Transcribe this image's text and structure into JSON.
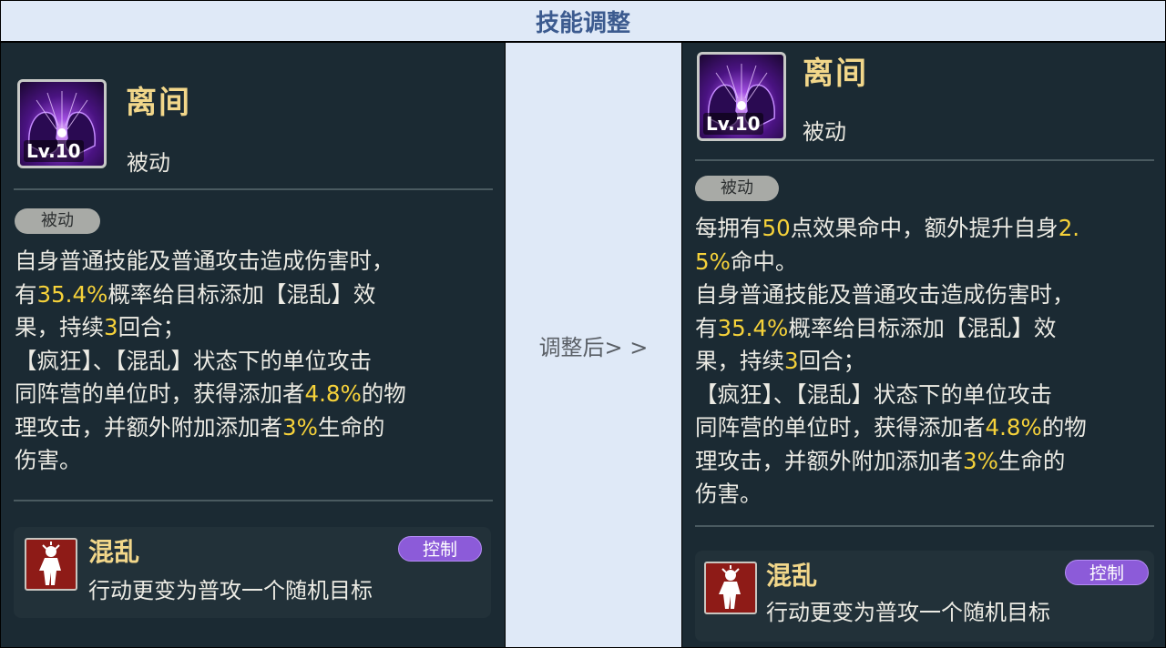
{
  "header": {
    "title": "技能调整"
  },
  "middle": {
    "label": "调整后> >"
  },
  "left": {
    "skill": {
      "level": "Lv.10",
      "name": "离间",
      "type": "被动",
      "pill": "被动"
    },
    "description": [
      [
        {
          "t": "自身普通技能及普通攻击造成伤害时，"
        }
      ],
      [
        {
          "t": "有"
        },
        {
          "t": "35.4%",
          "hl": true
        },
        {
          "t": "概率给目标添加【混乱】效"
        }
      ],
      [
        {
          "t": "果，持续"
        },
        {
          "t": "3",
          "hl": true
        },
        {
          "t": "回合；"
        }
      ],
      [
        {
          "t": "【疯狂】、【混乱】状态下的单位攻击"
        }
      ],
      [
        {
          "t": "同阵营的单位时，获得添加者"
        },
        {
          "t": "4.8%",
          "hl": true
        },
        {
          "t": "的物"
        }
      ],
      [
        {
          "t": "理攻击，并额外附加添加者"
        },
        {
          "t": "3%",
          "hl": true
        },
        {
          "t": "生命的"
        }
      ],
      [
        {
          "t": "伤害。"
        }
      ]
    ],
    "effect": {
      "name": "混乱",
      "tag": "控制",
      "description": "行动更变为普攻一个随机目标"
    }
  },
  "right": {
    "skill": {
      "level": "Lv.10",
      "name": "离间",
      "type": "被动",
      "pill": "被动"
    },
    "description": [
      [
        {
          "t": "每拥有"
        },
        {
          "t": "50",
          "hl": true
        },
        {
          "t": "点效果命中，额外提升自身"
        },
        {
          "t": "2.",
          "hl": true
        }
      ],
      [
        {
          "t": "5%",
          "hl": true
        },
        {
          "t": "命中。"
        }
      ],
      [
        {
          "t": "自身普通技能及普通攻击造成伤害时，"
        }
      ],
      [
        {
          "t": "有"
        },
        {
          "t": "35.4%",
          "hl": true
        },
        {
          "t": "概率给目标添加【混乱】效"
        }
      ],
      [
        {
          "t": "果，持续"
        },
        {
          "t": "3",
          "hl": true
        },
        {
          "t": "回合；"
        }
      ],
      [
        {
          "t": "【疯狂】、【混乱】状态下的单位攻击"
        }
      ],
      [
        {
          "t": "同阵营的单位时，获得添加者"
        },
        {
          "t": "4.8%",
          "hl": true
        },
        {
          "t": "的物"
        }
      ],
      [
        {
          "t": "理攻击，并额外附加添加者"
        },
        {
          "t": "3%",
          "hl": true
        },
        {
          "t": "生命的"
        }
      ],
      [
        {
          "t": "伤害。"
        }
      ]
    ],
    "effect": {
      "name": "混乱",
      "tag": "控制",
      "description": "行动更变为普攻一个随机目标"
    }
  },
  "colors": {
    "highlight": "#f6d23a",
    "skill_name": "#f2d78a",
    "panel_bg": "#1b2a33",
    "header_bg": "#dfe9f7",
    "tag_purple": "#8c5bd9"
  },
  "icons": {
    "skill": "purple-twin-silhouette-icon",
    "effect": "confused-figure-icon"
  }
}
